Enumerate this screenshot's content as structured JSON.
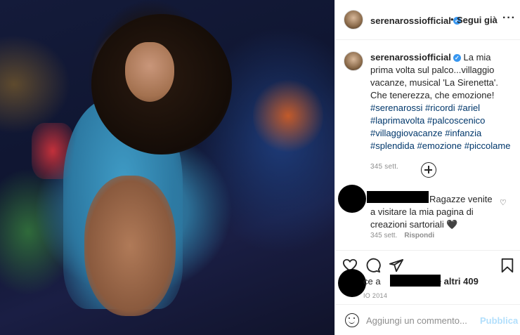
{
  "post": {
    "username": "serenarossiofficial",
    "follow_label": "Segui già",
    "dot": "•",
    "more_label": "···"
  },
  "caption": {
    "username": "serenarossiofficial",
    "text": "La mia prima volta sul palco...villaggio vacanze, musical 'La Sirenetta'. Che tenerezza, che emozione!",
    "hashtags": "#serenarossi #ricordi #ariel #laprimavolta #palcoscenico #villaggiovacanze #infanzia #splendida #emozione #piccolame",
    "time": "345 sett."
  },
  "comment": {
    "text": "Ragazze venite a visitare la mia pagina di creazioni sartoriali 🖤",
    "time": "345 sett.",
    "reply_label": "Rispondi"
  },
  "likes": {
    "prefix": "ce a",
    "suffix": "e altri 409"
  },
  "date": "IO 2014",
  "add_comment": {
    "placeholder": "Aggiungi un commento...",
    "publish_label": "Pubblica"
  },
  "icons": {
    "heart": "heart-icon",
    "comment": "comment-icon",
    "share": "share-icon",
    "bookmark": "bookmark-icon",
    "verified": "verified-badge-icon",
    "plus": "load-more-plus-icon",
    "emoji": "emoji-icon"
  },
  "colors": {
    "link": "#00376b",
    "verified": "#3897f0",
    "publish_disabled": "#b2dffc",
    "muted": "#8e8e8e"
  }
}
